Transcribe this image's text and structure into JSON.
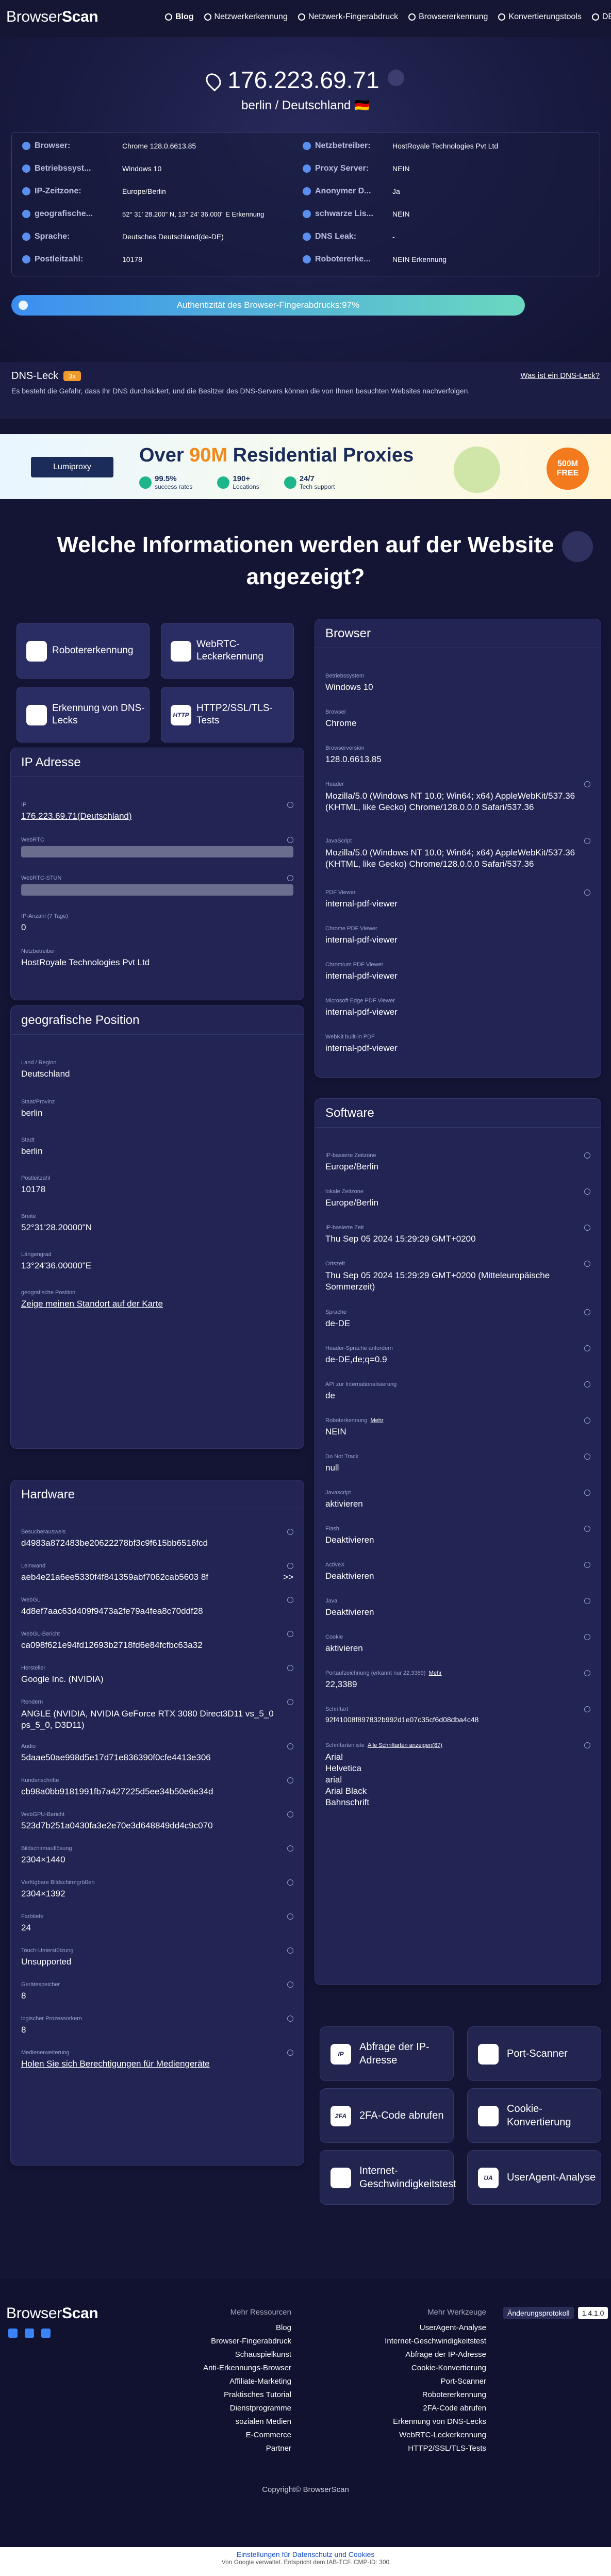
{
  "nav": {
    "logo_a": "Browser",
    "logo_b": "Scan",
    "links": [
      "Blog",
      "Netzwerkerkennung",
      "Netzwerk-Fingerabdruck",
      "Browsererkennung",
      "Konvertierungstools",
      "DE"
    ]
  },
  "hero": {
    "ip": "176.223.69.71",
    "location": "berlin / Deutschland",
    "flag": "🇩🇪",
    "left": [
      {
        "label": "Browser:",
        "value": "Chrome 128.0.6613.85"
      },
      {
        "label": "Betriebssyst...",
        "value": "Windows 10"
      },
      {
        "label": "IP-Zeitzone:",
        "value": "Europe/Berlin"
      },
      {
        "label": "geografische...",
        "value": "52° 31' 28.200\" N, 13° 24' 36.000\" E Erkennung"
      },
      {
        "label": "Sprache:",
        "value": "Deutsches Deutschland(de-DE)"
      },
      {
        "label": "Postleitzahl:",
        "value": "10178"
      }
    ],
    "right": [
      {
        "label": "Netzbetreiber:",
        "value": "HostRoyale Technologies Pvt Ltd"
      },
      {
        "label": "Proxy Server:",
        "value": "NEIN"
      },
      {
        "label": "Anonymer D...",
        "value": "Ja"
      },
      {
        "label": "schwarze Lis...",
        "value": "NEIN"
      },
      {
        "label": "DNS Leak:",
        "value": "-"
      },
      {
        "label": "Robotererke...",
        "value": "NEIN Erkennung"
      }
    ],
    "progress_text": "Authentizität des Browser-Fingerabdrucks:97%",
    "progress_value": 0.97
  },
  "dns": {
    "title": "DNS-Leck",
    "badge": "3x",
    "text": "Es besteht die Gefahr, dass Ihr DNS durchsickert, und die Besitzer des DNS-Servers können die von Ihnen besuchten Websites nachverfolgen.",
    "link": "Was ist ein DNS-Leck?"
  },
  "banner": {
    "brand": "Lumiproxy",
    "headline_a": "Over ",
    "headline_b": "90M",
    "headline_c": " Residential Proxies",
    "s1a": "99.5%",
    "s1b": "success rates",
    "s2a": "190+",
    "s2b": "Locations",
    "s3a": "24/7",
    "s3b": "Tech support",
    "badge_a": "500M",
    "badge_b": "FREE"
  },
  "heading": "Welche Informationen werden auf der Website angezeigt?",
  "quick": [
    "Roboterer­kennung",
    "WebRTC-Leckerkennung",
    "Erkennung von DNS-Lecks",
    "HTTP2/SSL/TLS-Tests"
  ],
  "quick_icons": [
    "",
    "",
    "",
    "HTTP"
  ],
  "ipcard": {
    "title": "IP Adresse",
    "fields": [
      {
        "label": "IP",
        "value": "176.223.69.71(Deutschland)"
      },
      {
        "label": "WebRTC",
        "value": ""
      },
      {
        "label": "WebRTC-STUN",
        "value": ""
      },
      {
        "label": "IP-Anzahl (7 Tage)",
        "value": "0"
      },
      {
        "label": "Netzbetreiber",
        "value": "HostRoyale Technologies Pvt Ltd"
      }
    ]
  },
  "geocard": {
    "title": "geografische Position",
    "fields": [
      {
        "label": "Land / Region",
        "value": "Deutschland"
      },
      {
        "label": "Staat/Provinz",
        "value": "berlin"
      },
      {
        "label": "Stadt",
        "value": "berlin"
      },
      {
        "label": "Postleitzahl",
        "value": "10178"
      },
      {
        "label": "Breite",
        "value": "52°31'28.20000\"N"
      },
      {
        "label": "Längengrad",
        "value": "13°24'36.00000\"E"
      },
      {
        "label": "geografische Position",
        "value": "Zeige meinen Standort auf der Karte"
      }
    ]
  },
  "hwcard": {
    "title": "Hardware",
    "fields": [
      {
        "label": "Besucherausweis",
        "value": "d4983a872483be20622278bf3c9f615bb6516fcd"
      },
      {
        "label": "Leinwand",
        "value": "aeb4e21a6ee5330f4f841359abf7062cab5603 8f",
        "extra": ">>"
      },
      {
        "label": "WebGL",
        "value": "4d8ef7aac63d409f9473a2fe79a4fea8c70ddf28"
      },
      {
        "label": "WebGL-Bericht",
        "value": "ca098f621e94fd12693b2718fd6e84fcfbc63a32"
      },
      {
        "label": "Hersteller",
        "value": "Google Inc. (NVIDIA)"
      },
      {
        "label": "Rendern",
        "value": "ANGLE (NVIDIA, NVIDIA GeForce RTX 3080 Direct3D11 vs_5_0 ps_5_0, D3D11)"
      },
      {
        "label": "Audio",
        "value": "5daae50ae998d5e17d71e836390f0cfe4413e306"
      },
      {
        "label": "Kundenschrifte",
        "value": "cb98a0bb9181991fb7a427225d5ee34b50e6e34d"
      },
      {
        "label": "WebGPU-Bericht",
        "value": "523d7b251a0430fa3e2e70e3d648849dd4c9c070"
      },
      {
        "label": "Bildschirmauflösung",
        "value": "2304×1440"
      },
      {
        "label": "Verfügbare Bildschirmgrößen",
        "value": "2304×1392"
      },
      {
        "label": "Farbtiefe",
        "value": "24"
      },
      {
        "label": "Touch-Unterstützung",
        "value": "Unsupported"
      },
      {
        "label": "Gerätespeicher",
        "value": "8"
      },
      {
        "label": "logischer Prozessorkern",
        "value": "8"
      },
      {
        "label": "Medienerweiterung",
        "value": "Holen Sie sich Berechtigungen für Mediengeräte"
      }
    ]
  },
  "browsercard": {
    "title": "Browser",
    "fields": [
      {
        "label": "Betriebssystem",
        "value": "Windows 10"
      },
      {
        "label": "Browser",
        "value": "Chrome"
      },
      {
        "label": "Browserversion",
        "value": "128.0.6613.85"
      },
      {
        "label": "Header",
        "value": "Mozilla/5.0 (Windows NT 10.0; Win64; x64) AppleWebKit/537.36 (KHTML, like Gecko) Chrome/128.0.0.0 Safari/537.36"
      },
      {
        "label": "JavaScript",
        "value": "Mozilla/5.0 (Windows NT 10.0; Win64; x64) AppleWebKit/537.36 (KHTML, like Gecko) Chrome/128.0.0.0 Safari/537.36"
      },
      {
        "label": "PDF Viewer",
        "value": "internal-pdf-viewer"
      },
      {
        "label": "Chrome PDF Viewer",
        "value": "internal-pdf-viewer"
      },
      {
        "label": "Chromium PDF Viewer",
        "value": "internal-pdf-viewer"
      },
      {
        "label": "Microsoft Edge PDF Viewer",
        "value": "internal-pdf-viewer"
      },
      {
        "label": "WebKit built-in PDF",
        "value": "internal-pdf-viewer"
      }
    ]
  },
  "softcard": {
    "title": "Software",
    "fields": [
      {
        "label": "IP-basierte Zeitzone",
        "value": "Europe/Berlin"
      },
      {
        "label": "lokale Zeitzone",
        "value": "Europe/Berlin"
      },
      {
        "label": "IP-basierte Zeit",
        "value": "Thu Sep 05 2024 15:29:29 GMT+0200"
      },
      {
        "label": "Ortszeit",
        "value": "Thu Sep 05 2024 15:29:29 GMT+0200 (Mitteleuropäische Sommerzeit)"
      },
      {
        "label": "Sprache",
        "value": "de-DE"
      },
      {
        "label": "Header-Sprache anfordern",
        "value": "de-DE,de;q=0.9"
      },
      {
        "label": "API zur Internationalisierung",
        "value": "de"
      },
      {
        "label": "Roboterkennung",
        "value": "NEIN",
        "more": "Mehr"
      },
      {
        "label": "Do Not Track",
        "value": "null"
      },
      {
        "label": "Javascript",
        "value": "aktivieren"
      },
      {
        "label": "Flash",
        "value": "Deaktivieren"
      },
      {
        "label": "ActiveX",
        "value": "Deaktivieren"
      },
      {
        "label": "Java",
        "value": "Deaktivieren"
      },
      {
        "label": "Cookie",
        "value": "aktivieren"
      },
      {
        "label": "Portaufzeichnung (erkannt nur 22,3389)",
        "value": "22,3389",
        "more": "Mehr"
      },
      {
        "label": "Schriftart",
        "value": "92f41008f897832b992d1e07c35cf6d08dba4c48"
      },
      {
        "label": "Schriftartenliste",
        "value": "Arial\nHelvetica\narial\nArial Black\nBahnschrift",
        "more": "Alle Schriftarten anzeigen(87)"
      }
    ]
  },
  "tools": [
    {
      "icon": "IP",
      "label": "Abfrage der IP-Adresse"
    },
    {
      "icon": "",
      "label": "Port-Scanner"
    },
    {
      "icon": "2FA",
      "label": "2FA-Code abrufen"
    },
    {
      "icon": "",
      "label": "Cookie-Konvertierung"
    },
    {
      "icon": "",
      "label": "Internet-Geschwindigkeitstest"
    },
    {
      "icon": "UA",
      "label": "UserAgent-Analyse"
    }
  ],
  "footer": {
    "col1_title": "Mehr Ressourcen",
    "col1": [
      "Blog",
      "Browser-Fingerabdruck",
      "Schauspielkunst",
      "Anti-Erkennungs-Browser",
      "Affiliate-Marketing",
      "Praktisches Tutorial",
      "Dienstprogramme",
      "sozialen Medien",
      "E-Commerce",
      "Partner"
    ],
    "col2_title": "Mehr Werkzeuge",
    "col2": [
      "UserAgent-Analyse",
      "Internet-Geschwindigkeitstest",
      "Abfrage der IP-Adresse",
      "Cookie-Konvertierung",
      "Port-Scanner",
      "Robotererkennung",
      "2FA-Code abrufen",
      "Erkennung von DNS-Lecks",
      "WebRTC-Leckerkennung",
      "HTTP2/SSL/TLS-Tests"
    ],
    "changelog": "Änderungsprotokoll",
    "version": "1.4.1.0",
    "copyright": "Copyright© BrowserScan"
  },
  "cookie": {
    "line1": "Einstellungen für Datenschutz und Cookies",
    "line2": "Von Google verwaltet. Entspricht dem IAB-TCF. CMP-ID: 300"
  }
}
